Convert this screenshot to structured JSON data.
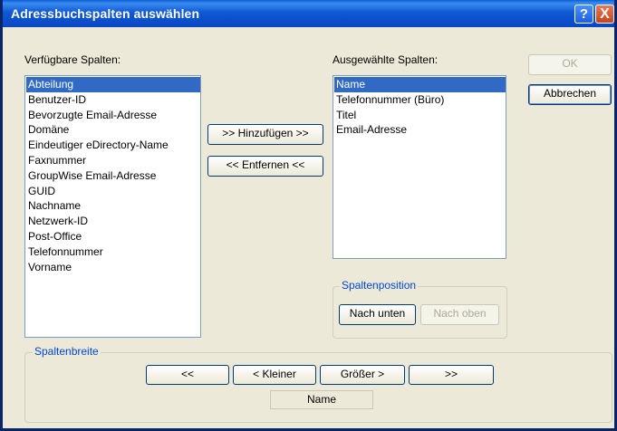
{
  "dialog": {
    "title": "Adressbuchspalten auswählen"
  },
  "titlebar_buttons": {
    "help": "?",
    "close": "X"
  },
  "available": {
    "label": "Verfügbare Spalten:",
    "items": [
      "Abteilung",
      "Benutzer-ID",
      "Bevorzugte Email-Adresse",
      "Domäne",
      "Eindeutiger eDirectory-Name",
      "Faxnummer",
      "GroupWise Email-Adresse",
      "GUID",
      "Nachname",
      "Netzwerk-ID",
      "Post-Office",
      "Telefonnummer",
      "Vorname"
    ],
    "selected_index": 0
  },
  "selected": {
    "label": "Ausgewählte Spalten:",
    "items": [
      "Name",
      "Telefonnummer (Büro)",
      "Titel",
      "Email-Adresse"
    ],
    "selected_index": 0
  },
  "buttons": {
    "add": ">> Hinzufügen >>",
    "remove": "<< Entfernen <<",
    "ok": "OK",
    "cancel": "Abbrechen"
  },
  "column_position": {
    "legend": "Spaltenposition",
    "down": "Nach unten",
    "up": "Nach oben"
  },
  "column_width": {
    "legend": "Spaltenbreite",
    "min": "<<",
    "smaller": "< Kleiner",
    "larger": "Größer >",
    "max": ">>",
    "current_column": "Name"
  }
}
